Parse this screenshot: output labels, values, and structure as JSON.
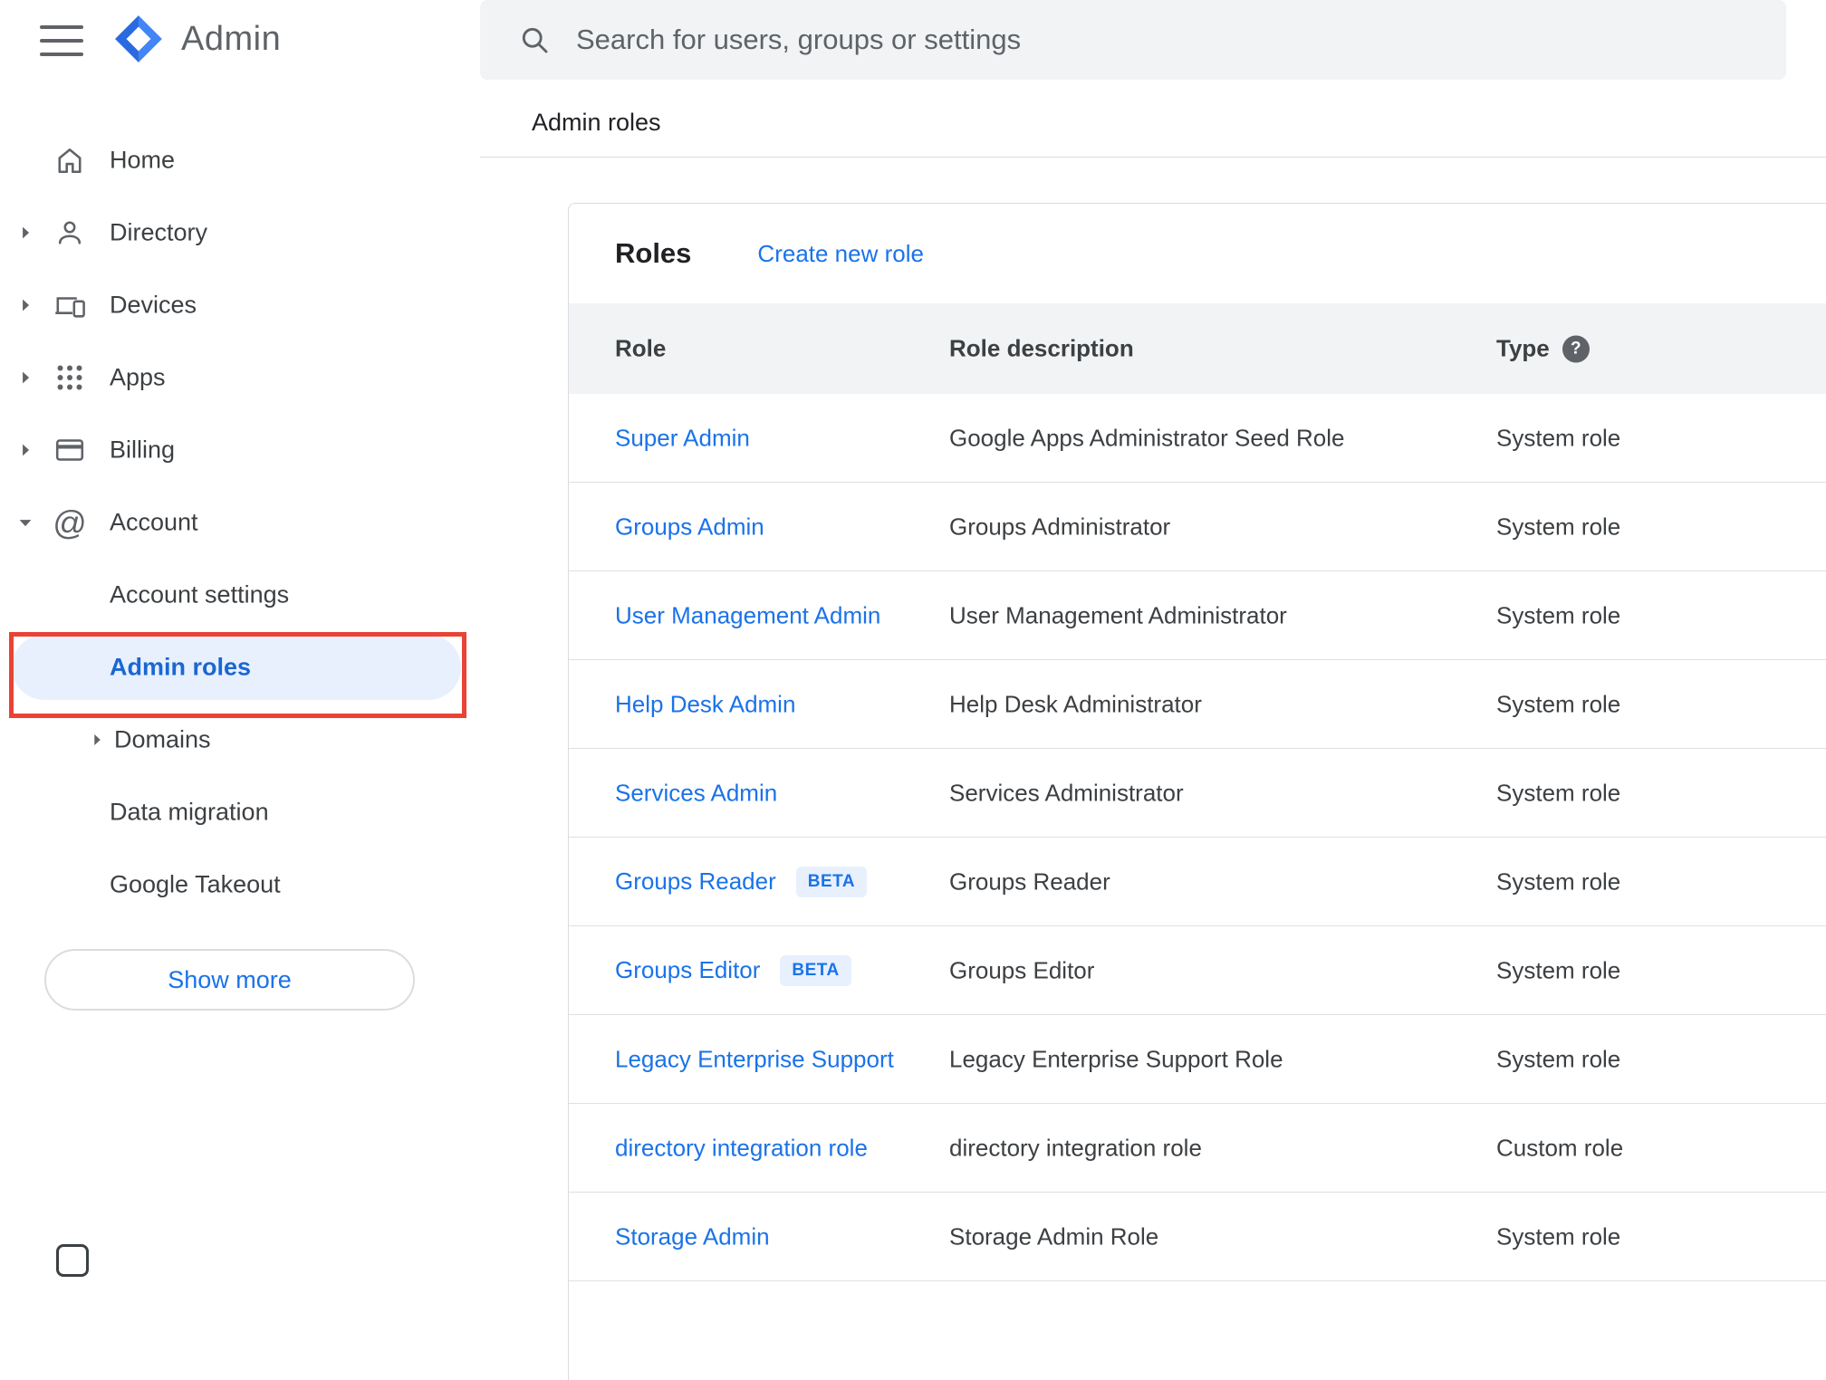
{
  "colors": {
    "accent_blue": "#1a73e8",
    "selected_blue": "#1967d2",
    "selected_bg": "#e8f0fe",
    "annotation_red": "#e94335",
    "icon_gray": "#5f6368",
    "text_dark": "#202124",
    "text_gray": "#3c4043",
    "panel_gray": "#f1f3f4"
  },
  "header": {
    "app_name": "Admin",
    "search": {
      "placeholder": "Search for users, groups or settings"
    },
    "breadcrumb": "Admin roles"
  },
  "sidebar": {
    "items": [
      {
        "label": "Home"
      },
      {
        "label": "Directory"
      },
      {
        "label": "Devices"
      },
      {
        "label": "Apps"
      },
      {
        "label": "Billing"
      },
      {
        "label": "Account"
      }
    ],
    "account_children": [
      {
        "label": "Account settings"
      },
      {
        "label": "Admin roles"
      },
      {
        "label": "Domains"
      },
      {
        "label": "Data migration"
      },
      {
        "label": "Google Takeout"
      }
    ],
    "show_more": "Show more"
  },
  "icons": {
    "at_glyph": "@",
    "help_glyph": "?"
  },
  "main": {
    "title": "Roles",
    "create_new_role": "Create new role",
    "table": {
      "headers": {
        "role": "Role",
        "description": "Role description",
        "type": "Type"
      },
      "beta_label": "BETA",
      "rows": [
        {
          "role": "Super Admin",
          "beta": false,
          "description": "Google Apps Administrator Seed Role",
          "type": "System role"
        },
        {
          "role": "Groups Admin",
          "beta": false,
          "description": "Groups Administrator",
          "type": "System role"
        },
        {
          "role": "User Management Admin",
          "beta": false,
          "description": "User Management Administrator",
          "type": "System role"
        },
        {
          "role": "Help Desk Admin",
          "beta": false,
          "description": "Help Desk Administrator",
          "type": "System role"
        },
        {
          "role": "Services Admin",
          "beta": false,
          "description": "Services Administrator",
          "type": "System role"
        },
        {
          "role": "Groups Reader",
          "beta": true,
          "description": "Groups Reader",
          "type": "System role"
        },
        {
          "role": "Groups Editor",
          "beta": true,
          "description": "Groups Editor",
          "type": "System role"
        },
        {
          "role": "Legacy Enterprise Support",
          "beta": false,
          "description": "Legacy Enterprise Support Role",
          "type": "System role"
        },
        {
          "role": "directory integration role",
          "beta": false,
          "description": "directory integration role",
          "type": "Custom role"
        },
        {
          "role": "Storage Admin",
          "beta": false,
          "description": "Storage Admin Role",
          "type": "System role"
        }
      ]
    }
  }
}
